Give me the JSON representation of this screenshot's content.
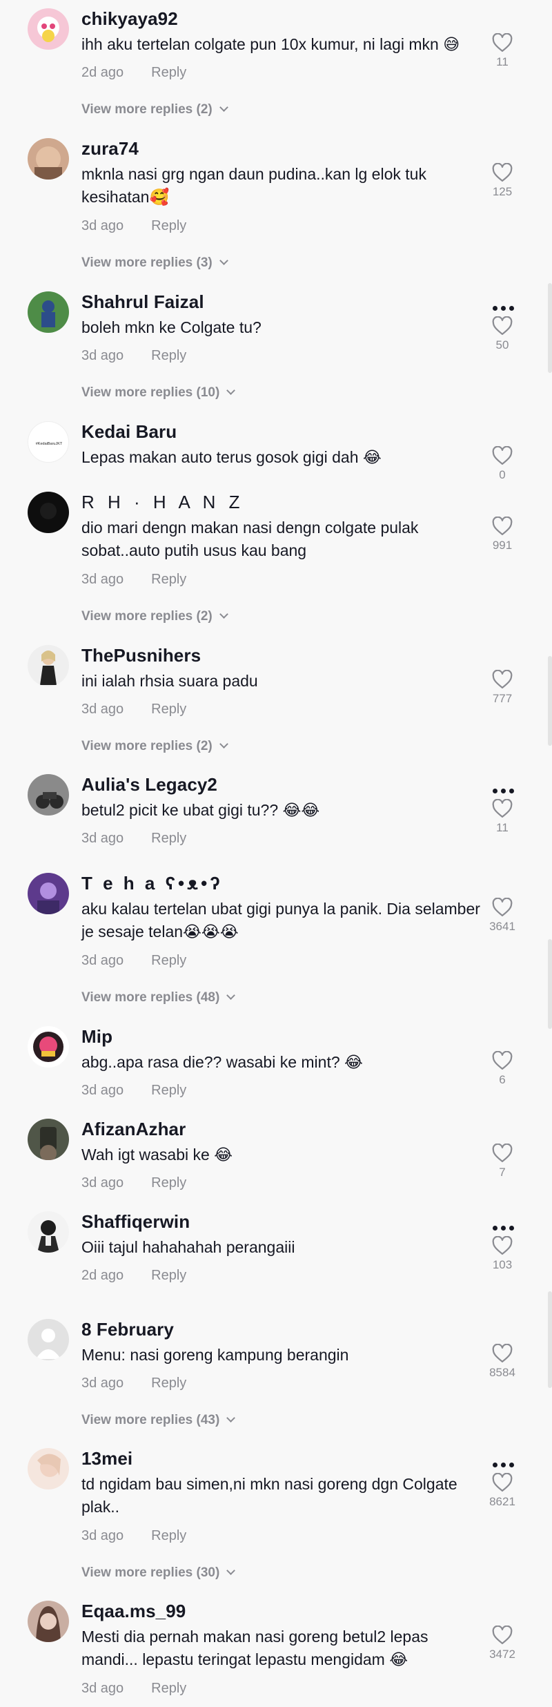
{
  "comments": [
    {
      "username": "chikyaya92",
      "text": "ihh aku tertelan colgate pun 10x kumur, ni lagi mkn 😅",
      "time": "2d ago",
      "reply_label": "Reply",
      "likes": "11",
      "view_more": "View more replies (2)",
      "avatar_color": "#f2b6c9"
    },
    {
      "username": "zura74",
      "text": "mknla nasi grg ngan daun pudina..kan lg elok tuk kesihatan🥰",
      "time": "3d ago",
      "reply_label": "Reply",
      "likes": "125",
      "view_more": "View more replies (3)",
      "avatar_color": "#b98a6e"
    },
    {
      "username": "Shahrul Faizal",
      "text": "boleh mkn ke Colgate tu?",
      "time": "3d ago",
      "reply_label": "Reply",
      "likes": "50",
      "view_more": "View more replies (10)",
      "avatar_color": "#3f7a3a"
    },
    {
      "username": "Kedai Baru",
      "text": "Lepas makan auto terus gosok gigi dah 😂",
      "likes": "0",
      "avatar_label": "#KedaiBaruJKT",
      "avatar_color": "#ffffff"
    },
    {
      "username": "R H · H A N Z",
      "text": "dio mari dengn makan nasi dengn colgate pulak sobat..auto putih usus kau bang",
      "time": "3d ago",
      "reply_label": "Reply",
      "likes": "991",
      "view_more": "View more replies (2)",
      "avatar_color": "#121212"
    },
    {
      "username": "ThePusnihers",
      "text": "ini ialah rhsia suara padu",
      "time": "3d ago",
      "reply_label": "Reply",
      "likes": "777",
      "view_more": "View more replies (2)",
      "avatar_color": "#e9e6e2"
    },
    {
      "username": "Aulia's Legacy2",
      "text": "betul2 picit ke ubat gigi tu?? 😂😂",
      "time": "3d ago",
      "reply_label": "Reply",
      "likes": "11",
      "avatar_color": "#6d6d6d"
    },
    {
      "username": "T e h a ʕ•ᴥ•ʔ",
      "text": "aku kalau tertelan ubat gigi punya la panik. Dia selamber je sesaje telan😭😭😭",
      "time": "3d ago",
      "reply_label": "Reply",
      "likes": "3641",
      "view_more": "View more replies (48)",
      "avatar_color": "#7a4fb0"
    },
    {
      "username": "Mip",
      "text": "abg..apa rasa die?? wasabi ke mint? 😂",
      "time": "3d ago",
      "reply_label": "Reply",
      "likes": "6",
      "avatar_color": "#2b1d22"
    },
    {
      "username": "AfizanAzhar",
      "text": "Wah igt wasabi ke 😂",
      "time": "3d ago",
      "reply_label": "Reply",
      "likes": "7",
      "avatar_color": "#4a4f46"
    },
    {
      "username": "Shaffiqerwin",
      "text": "Oiii tajul hahahahah perangaiii",
      "time": "2d ago",
      "reply_label": "Reply",
      "likes": "103",
      "avatar_color": "#d8d8d8"
    },
    {
      "username": "8 February",
      "text": "Menu: nasi goreng kampung berangin",
      "time": "3d ago",
      "reply_label": "Reply",
      "likes": "8584",
      "view_more": "View more replies (43)",
      "avatar_color": "#e2e2e2"
    },
    {
      "username": "13mei",
      "text": "td ngidam bau simen,ni mkn nasi goreng dgn Colgate plak..",
      "time": "3d ago",
      "reply_label": "Reply",
      "likes": "8621",
      "view_more": "View more replies (30)",
      "avatar_color": "#f1ddd4"
    },
    {
      "username": "Eqaa.ms_99",
      "text": "Mesti dia pernah makan nasi goreng betul2 lepas mandi... lepastu teringat lepastu mengidam 😂",
      "time": "3d ago",
      "reply_label": "Reply",
      "likes": "3472",
      "avatar_color": "#b49587"
    }
  ],
  "heart_icon": "heart-outline-icon",
  "more_icon": "more-options-icon"
}
